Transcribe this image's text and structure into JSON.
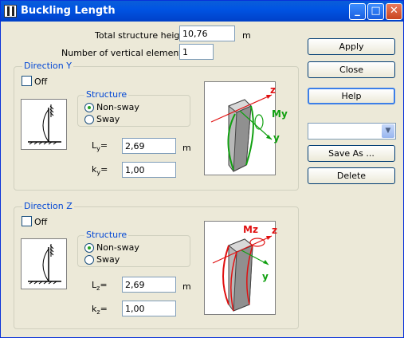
{
  "window": {
    "title": "Buckling Length"
  },
  "title_buttons": {
    "minimize": "_",
    "maximize": "□",
    "close": "✕"
  },
  "fields": {
    "total_height_label": "Total structure height:",
    "total_height_value": "10,76",
    "total_height_unit": "m",
    "vertical_elements_label": "Number of vertical elements m:",
    "vertical_elements_value": "1"
  },
  "buttons": {
    "apply": "Apply",
    "close": "Close",
    "help": "Help",
    "save_as": "Save As ...",
    "delete": "Delete"
  },
  "preset_combo": {
    "value": ""
  },
  "direction_y": {
    "title": "Direction Y",
    "off_label": "Off",
    "structure_label": "Structure",
    "options": [
      "Non-sway",
      "Sway"
    ],
    "selected": "Non-sway",
    "l_label": "L",
    "l_sub": "y",
    "l_value": "2,69",
    "l_unit": "m",
    "k_label": "k",
    "k_sub": "y",
    "k_value": "1,00",
    "axis_z": "z",
    "axis_y": "y",
    "moment": "My"
  },
  "direction_z": {
    "title": "Direction Z",
    "off_label": "Off",
    "structure_label": "Structure",
    "options": [
      "Non-sway",
      "Sway"
    ],
    "selected": "Non-sway",
    "l_label": "L",
    "l_sub": "z",
    "l_value": "2,69",
    "l_unit": "m",
    "k_label": "k",
    "k_sub": "z",
    "k_value": "1,00",
    "axis_z": "z",
    "axis_y": "y",
    "moment": "Mz"
  },
  "eq": "=",
  "colors": {
    "titlebar": "#0054e3",
    "group_label": "#0046d5",
    "radio_dot": "#21a121",
    "axis_red": "#e01010",
    "axis_green": "#10a010"
  }
}
